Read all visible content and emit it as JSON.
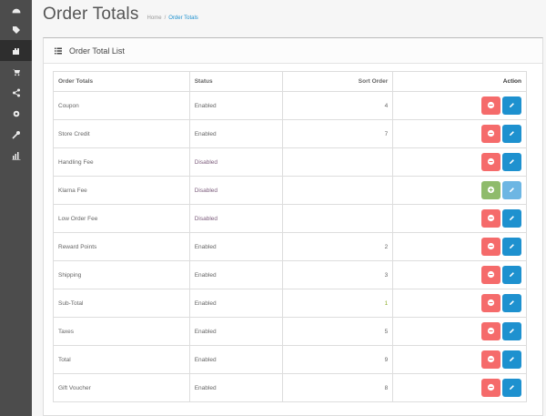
{
  "header": {
    "title": "Order Totals",
    "breadcrumb": [
      "Home",
      "Order Totals"
    ],
    "breadcrumb_sep": "/"
  },
  "panel": {
    "title": "Order Total List"
  },
  "table": {
    "headers": [
      "Order Totals",
      "Status",
      "Sort Order",
      "Action"
    ],
    "rows": [
      {
        "name": "Coupon",
        "status": "Enabled",
        "sort": "4",
        "installed": true
      },
      {
        "name": "Store Credit",
        "status": "Enabled",
        "sort": "7",
        "installed": true
      },
      {
        "name": "Handling Fee",
        "status": "Disabled",
        "sort": "",
        "installed": true
      },
      {
        "name": "Klarna Fee",
        "status": "Disabled",
        "sort": "",
        "installed": false
      },
      {
        "name": "Low Order Fee",
        "status": "Disabled",
        "sort": "",
        "installed": true
      },
      {
        "name": "Reward Points",
        "status": "Enabled",
        "sort": "2",
        "installed": true
      },
      {
        "name": "Shipping",
        "status": "Enabled",
        "sort": "3",
        "installed": true
      },
      {
        "name": "Sub-Total",
        "status": "Enabled",
        "sort": "1",
        "installed": true
      },
      {
        "name": "Taxes",
        "status": "Enabled",
        "sort": "5",
        "installed": true
      },
      {
        "name": "Total",
        "status": "Enabled",
        "sort": "9",
        "installed": true
      },
      {
        "name": "Gift Voucher",
        "status": "Enabled",
        "sort": "8",
        "installed": true
      }
    ]
  },
  "sidebar": {
    "icons": [
      "dashboard-icon",
      "tags-icon",
      "puzzle-icon",
      "cart-icon",
      "share-icon",
      "cog-icon",
      "wrench-icon",
      "bar-chart-icon"
    ],
    "active_index": 2
  },
  "colors": {
    "uninstall": "#f56b6b",
    "edit": "#1e91cf",
    "install": "#8fbb6c",
    "edit_disabled": "#6db6e3",
    "sidebar": "#4c4c4c"
  }
}
